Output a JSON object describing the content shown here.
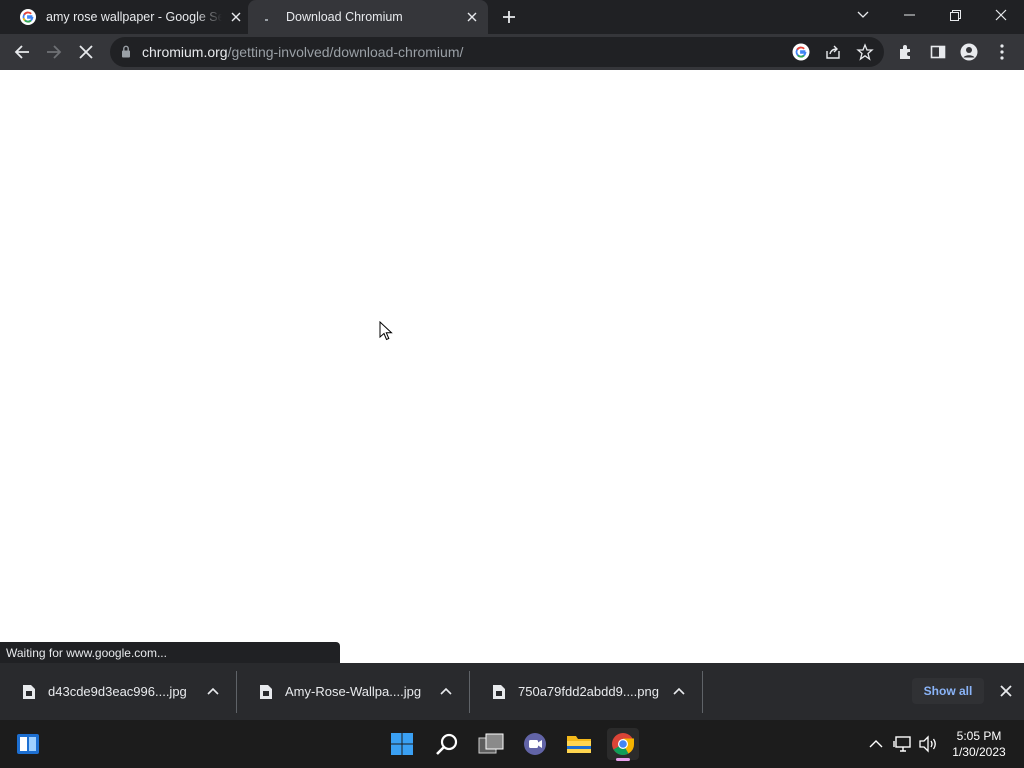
{
  "browser": {
    "tabs": [
      {
        "title": "amy rose wallpaper - Google Search",
        "favicon": "google-g-icon",
        "active": false
      },
      {
        "title": "Download Chromium",
        "favicon": "loading-icon",
        "active": true
      }
    ],
    "new_tab_icon": "plus-icon",
    "window_controls": [
      "tab-search-icon",
      "minimize-icon",
      "restore-icon",
      "close-icon"
    ]
  },
  "toolbar": {
    "url_host": "chromium.org",
    "url_path": "/getting-involved/download-chromium/",
    "icons": [
      "back-icon",
      "forward-icon",
      "stop-icon",
      "lock-icon",
      "google-lens-icon",
      "share-icon",
      "bookmark-star-icon",
      "extensions-icon",
      "side-panel-icon",
      "profile-icon",
      "menu-icon"
    ]
  },
  "status": {
    "text": "Waiting for www.google.com..."
  },
  "downloads": {
    "items": [
      {
        "filename": "d43cde9d3eac996....jpg"
      },
      {
        "filename": "Amy-Rose-Wallpa....jpg"
      },
      {
        "filename": "750a79fdd2abdd9....png"
      }
    ],
    "show_all_label": "Show all"
  },
  "taskbar": {
    "apps": [
      "windows-start-icon",
      "search-icon",
      "task-view-icon",
      "teams-chat-icon",
      "file-explorer-icon",
      "chrome-icon"
    ],
    "time": "5:05 PM",
    "date": "1/30/2023"
  },
  "colors": {
    "tab_strip": "#202124",
    "toolbar": "#35363a",
    "accent_link": "#8ab4f8",
    "taskbar": "#1c1c1c"
  }
}
